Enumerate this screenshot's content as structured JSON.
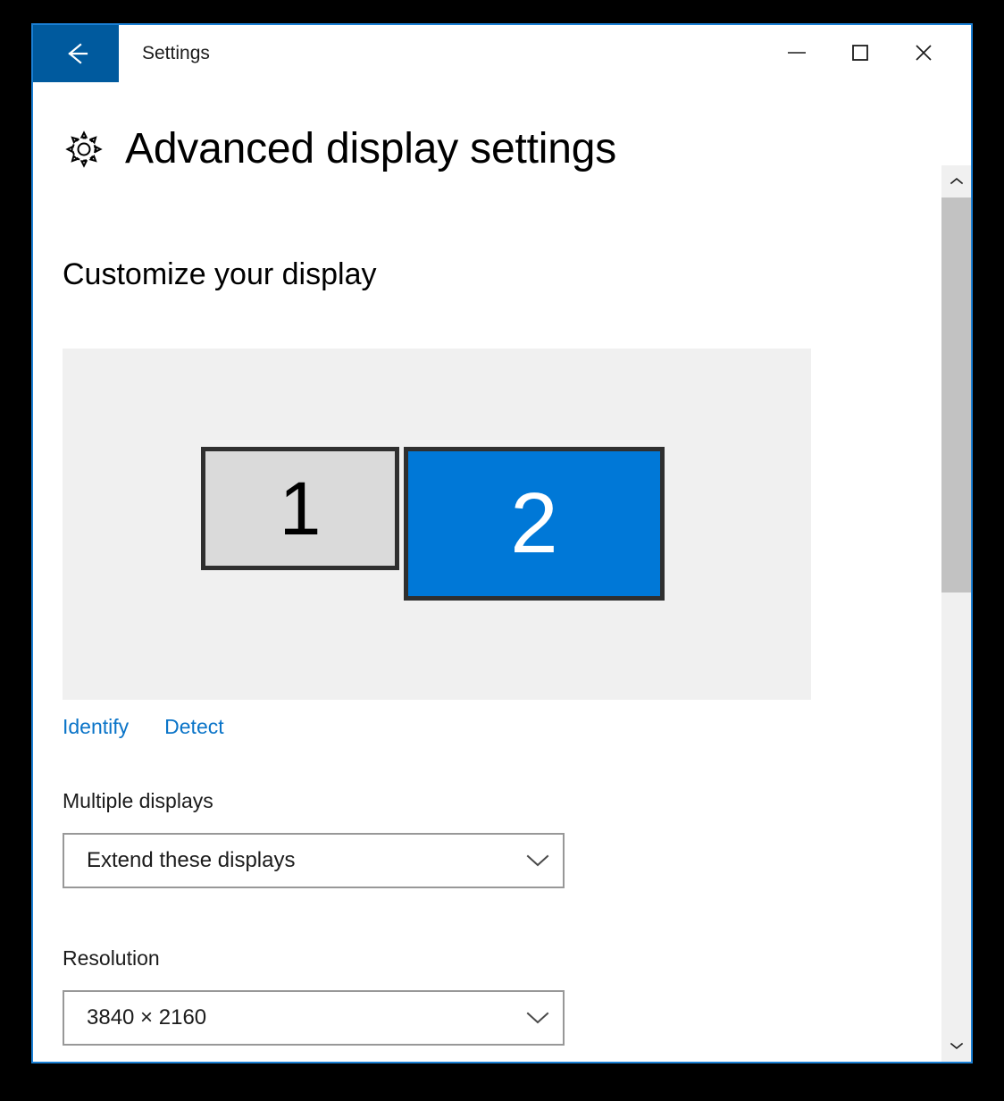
{
  "window": {
    "title": "Settings",
    "back_icon": "back-arrow-icon",
    "minimize_icon": "minimize-icon",
    "maximize_icon": "maximize-icon",
    "close_icon": "close-icon",
    "border_color": "#1a7fd4"
  },
  "page": {
    "icon": "gear-icon",
    "title": "Advanced display settings",
    "section_heading": "Customize your display"
  },
  "display_panel": {
    "background_color": "#f0f0f0",
    "monitors": [
      {
        "label": "1",
        "selected": false,
        "fill_color": "#dadada",
        "text_color": "#000000"
      },
      {
        "label": "2",
        "selected": true,
        "fill_color": "#0078d7",
        "text_color": "#ffffff"
      }
    ]
  },
  "links": [
    {
      "label": "Identify",
      "name": "identify-link"
    },
    {
      "label": "Detect",
      "name": "detect-link"
    }
  ],
  "link_color": "#0a74c8",
  "fields": {
    "multiple_displays": {
      "label": "Multiple displays",
      "value": "Extend these displays",
      "chevron_icon": "chevron-down-icon"
    },
    "resolution": {
      "label": "Resolution",
      "value": "3840 × 2160",
      "chevron_icon": "chevron-down-icon"
    }
  },
  "scrollbar": {
    "up_icon": "chevron-up-icon",
    "down_icon": "chevron-down-icon",
    "thumb_color": "#c2c2c2",
    "track_color": "#f0f0f0"
  }
}
